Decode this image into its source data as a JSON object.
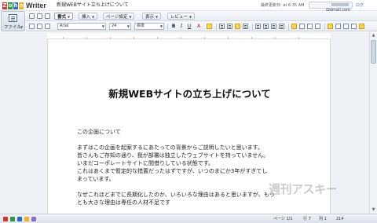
{
  "app": {
    "logo_letters": [
      "Z",
      "o",
      "h",
      "o"
    ],
    "logo_colors": [
      "#d9342b",
      "#2f9a3a",
      "#2a6dc6",
      "#f0b323"
    ],
    "name": "Writer",
    "document_title": "新規WEBサイト立ち上げについて",
    "last_saved": "最終更新日: at 6:35 AM",
    "user_email_suffix": "@gmail.com",
    "top_right_link": "ログ"
  },
  "file_menu": {
    "label": "ファイル",
    "icon": "document-icon"
  },
  "toolbar": {
    "tabs": [
      {
        "label": "書式",
        "active": true
      },
      {
        "label": "挿入",
        "active": false
      },
      {
        "label": "ページ設定",
        "active": false
      },
      {
        "label": "表示",
        "active": false
      },
      {
        "label": "レビュー",
        "active": false
      }
    ],
    "font_name": "Arial",
    "font_size": "24",
    "style": "標準",
    "bold": "B",
    "italic": "I",
    "underline": "U",
    "font_color": "A"
  },
  "document": {
    "heading": "新規WEBサイトの立ち上げについて",
    "paragraphs": [
      "この企画について",
      "まずはこの企画を起案するにあたっての背景からご説明したいと思います。",
      "皆さんもご存知の通り、我が部署は独立したウェブサイトを持っていません。",
      "いまだコーポレートサイトに間借りしている状態です。",
      "これはあくまで暫定的な措置だったはずですが、いつのまにか3年がすぎてし",
      "まっています。",
      "なぜこれほどまでに長期化したのか、いろいろな理由はあると思いますが、もっ",
      "とも大きな理由は専任の人材不足です"
    ]
  },
  "status_bar": {
    "page": "ページ 1/1",
    "line": "行 7",
    "column": "列 1",
    "zoom": "214"
  },
  "watermark": "週刊アスキー",
  "colors": {
    "accent": "#2a6dc6",
    "toolbar_bg": "#e9eef5",
    "document_bg": "#eef1f5"
  }
}
